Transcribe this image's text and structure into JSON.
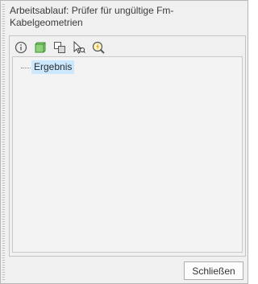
{
  "pane": {
    "title": "Arbeitsablauf: Prüfer für ungültige Fm-Kabelgeometrien"
  },
  "toolbar": {
    "buttons": [
      {
        "icon": "info-icon"
      },
      {
        "icon": "green-feature-icon"
      },
      {
        "icon": "overlap-layers-icon"
      },
      {
        "icon": "select-pointer-icon"
      },
      {
        "icon": "zoom-flash-icon"
      }
    ]
  },
  "tree": {
    "items": [
      {
        "label": "Ergebnis",
        "selected": true
      }
    ]
  },
  "footer": {
    "close_label": "Schließen"
  },
  "colors": {
    "selection": "#cce8ff",
    "pane_background": "#f0f0f0",
    "info_icon": "#5a5a5a",
    "feature_icon": "#4caf50",
    "flash_icon": "#e6a100"
  }
}
